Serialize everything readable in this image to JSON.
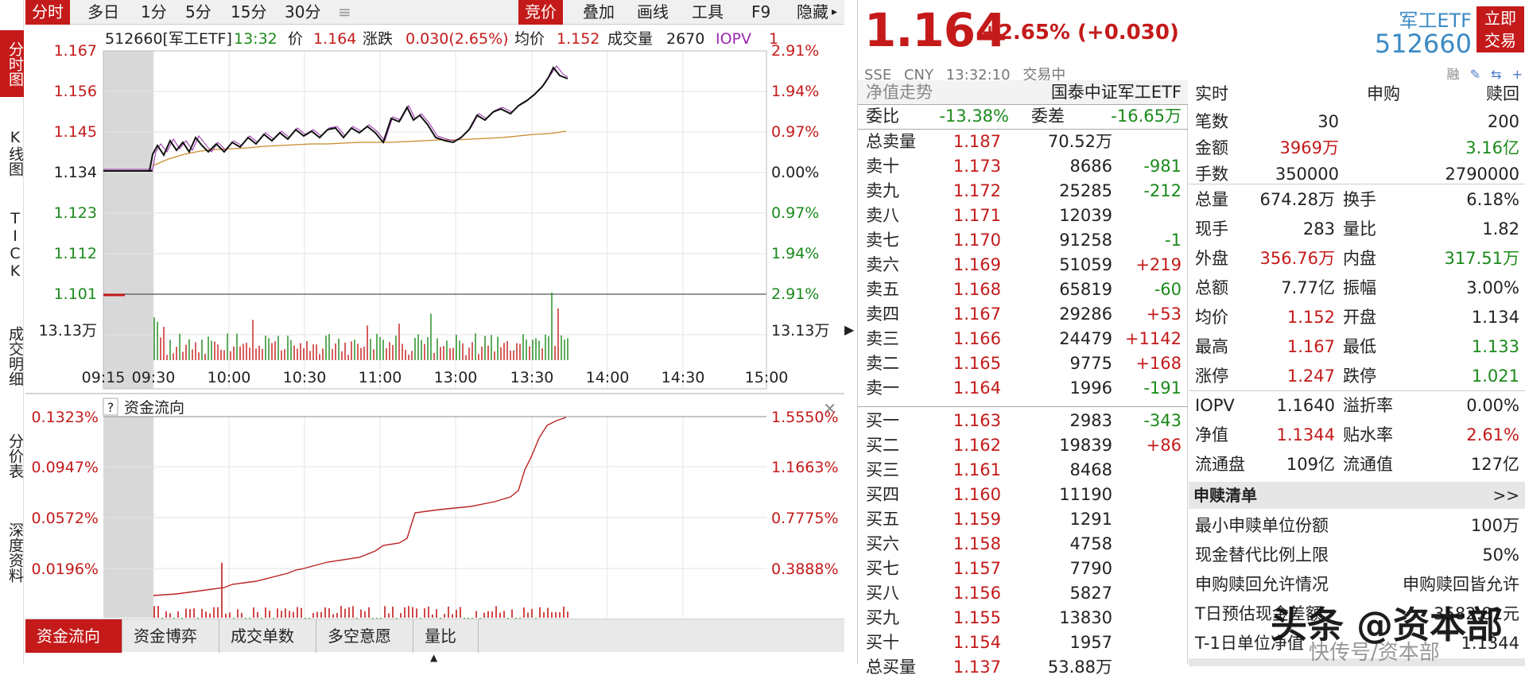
{
  "vtabs": [
    "分时图",
    "K线图",
    "TICK",
    "成交明细",
    "分价表",
    "深度资料"
  ],
  "toolbar": {
    "left": [
      "分时",
      "多日",
      "1分",
      "5分",
      "15分",
      "30分"
    ],
    "right": [
      "竞价",
      "叠加",
      "画线",
      "工具",
      "F9",
      "隐藏"
    ]
  },
  "main_chart": {
    "info": {
      "name": "512660[军工ETF]",
      "time": "13:32",
      "price_label": "价",
      "price": "1.164",
      "chg_label": "涨跌",
      "chg": "0.030(2.65%)",
      "avg_label": "均价",
      "avg": "1.152",
      "vol_label": "成交量",
      "vol": "2670",
      "iopv": "IOPV"
    },
    "y_left": [
      "1.167",
      "1.156",
      "1.145",
      "1.134",
      "1.123",
      "1.112",
      "1.101"
    ],
    "y_right": [
      "2.91%",
      "1.94%",
      "0.97%",
      "0.00%",
      "0.97%",
      "1.94%",
      "2.91%"
    ],
    "vol_label": "13.13万",
    "x_labels": [
      "09:15",
      "09:30",
      "10:00",
      "10:30",
      "11:00",
      "13:00",
      "13:30",
      "14:00",
      "14:30",
      "15:00"
    ]
  },
  "flow_chart": {
    "title": "资金流向",
    "help": "?",
    "y_left": [
      "0.1323%",
      "0.0947%",
      "0.0572%",
      "0.0196%"
    ],
    "y_right": [
      "1.5550%",
      "1.1663%",
      "0.7775%",
      "0.3888%"
    ]
  },
  "bottom_tabs": [
    "资金流向",
    "资金博弈",
    "成交单数",
    "多空意愿",
    "量比"
  ],
  "quote": {
    "price": "1.164",
    "change": "+2.65% (+0.030)",
    "exchange": "SSE",
    "currency": "CNY",
    "time": "13:32:10",
    "status": "交易中",
    "name": "军工ETF",
    "code": "512660",
    "trade_btn": [
      "立即",
      "交易"
    ],
    "mini_icons": [
      "融",
      "✎",
      "⇆",
      "+"
    ]
  },
  "book": {
    "nav_label": "净值走势",
    "fund_name": "国泰中证军工ETF",
    "weibi_label": "委比",
    "weibi": "-13.38%",
    "weicha_label": "委差",
    "weicha": "-16.65万",
    "total_sell": {
      "label": "总卖量",
      "price": "1.187",
      "vol": "70.52万"
    },
    "asks": [
      {
        "label": "卖十",
        "price": "1.173",
        "vol": "8686",
        "chg": "-981"
      },
      {
        "label": "卖九",
        "price": "1.172",
        "vol": "25285",
        "chg": "-212"
      },
      {
        "label": "卖八",
        "price": "1.171",
        "vol": "12039",
        "chg": ""
      },
      {
        "label": "卖七",
        "price": "1.170",
        "vol": "91258",
        "chg": "-1"
      },
      {
        "label": "卖六",
        "price": "1.169",
        "vol": "51059",
        "chg": "+219"
      },
      {
        "label": "卖五",
        "price": "1.168",
        "vol": "65819",
        "chg": "-60"
      },
      {
        "label": "卖四",
        "price": "1.167",
        "vol": "29286",
        "chg": "+53"
      },
      {
        "label": "卖三",
        "price": "1.166",
        "vol": "24479",
        "chg": "+1142"
      },
      {
        "label": "卖二",
        "price": "1.165",
        "vol": "9775",
        "chg": "+168"
      },
      {
        "label": "卖一",
        "price": "1.164",
        "vol": "1996",
        "chg": "-191"
      }
    ],
    "bids": [
      {
        "label": "买一",
        "price": "1.163",
        "vol": "2983",
        "chg": "-343"
      },
      {
        "label": "买二",
        "price": "1.162",
        "vol": "19839",
        "chg": "+86"
      },
      {
        "label": "买三",
        "price": "1.161",
        "vol": "8468",
        "chg": ""
      },
      {
        "label": "买四",
        "price": "1.160",
        "vol": "11190",
        "chg": ""
      },
      {
        "label": "买五",
        "price": "1.159",
        "vol": "1291",
        "chg": ""
      },
      {
        "label": "买六",
        "price": "1.158",
        "vol": "4758",
        "chg": ""
      },
      {
        "label": "买七",
        "price": "1.157",
        "vol": "7790",
        "chg": ""
      },
      {
        "label": "买八",
        "price": "1.156",
        "vol": "5827",
        "chg": ""
      },
      {
        "label": "买九",
        "price": "1.155",
        "vol": "13830",
        "chg": ""
      },
      {
        "label": "买十",
        "price": "1.154",
        "vol": "1957",
        "chg": ""
      }
    ],
    "total_buy": {
      "label": "总买量",
      "price": "1.137",
      "vol": "53.88万"
    }
  },
  "stats": {
    "realtime": {
      "label": "实时",
      "col1": "申购",
      "col2": "赎回"
    },
    "rt_rows": [
      {
        "label": "笔数",
        "v1": "30",
        "v2": "200"
      },
      {
        "label": "金额",
        "v1": "3969万",
        "v2": "3.16亿"
      },
      {
        "label": "手数",
        "v1": "350000",
        "v2": "2790000"
      }
    ],
    "pairs": [
      {
        "l1": "总量",
        "v1": "674.28万",
        "l2": "换手",
        "v2": "6.18%"
      },
      {
        "l1": "现手",
        "v1": "283",
        "l2": "量比",
        "v2": "1.82"
      },
      {
        "l1": "外盘",
        "v1": "356.76万",
        "l2": "内盘",
        "v2": "317.51万"
      },
      {
        "l1": "总额",
        "v1": "7.77亿",
        "l2": "振幅",
        "v2": "3.00%"
      },
      {
        "l1": "均价",
        "v1": "1.152",
        "l2": "开盘",
        "v2": "1.134"
      },
      {
        "l1": "最高",
        "v1": "1.167",
        "l2": "最低",
        "v2": "1.133"
      },
      {
        "l1": "涨停",
        "v1": "1.247",
        "l2": "跌停",
        "v2": "1.021"
      },
      {
        "l1": "IOPV",
        "v1": "1.1640",
        "l2": "溢折率",
        "v2": "0.00%"
      },
      {
        "l1": "净值",
        "v1": "1.1344",
        "l2": "贴水率",
        "v2": "2.61%"
      },
      {
        "l1": "流通盘",
        "v1": "109亿",
        "l2": "流通值",
        "v2": "127亿"
      }
    ],
    "sg_title": "申赎清单",
    "sg_more": ">>",
    "sg_rows": [
      {
        "label": "最小申赎单位份额",
        "value": "100万"
      },
      {
        "label": "现金替代比例上限",
        "value": "50%"
      },
      {
        "label": "申购赎回允许情况",
        "value": "申购赎回皆允许"
      },
      {
        "label": "T日预估现金差额",
        "value": "3582.81元"
      },
      {
        "label": "T-1日单位净值",
        "value": "1.1344"
      }
    ],
    "bottom_partial": "近5日净流入"
  },
  "watermark": "头条 @资本部",
  "watermark_sub": "快传号/资本部"
}
